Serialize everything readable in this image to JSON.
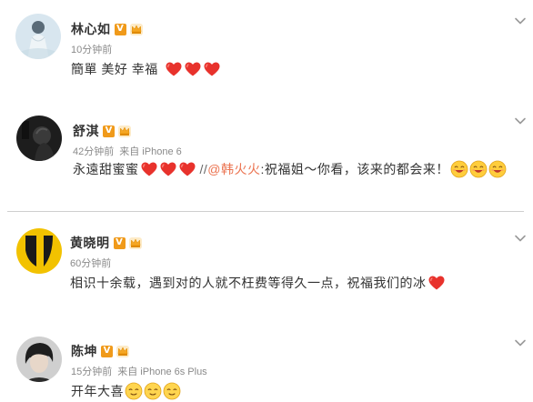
{
  "posts": [
    {
      "name": "林心如",
      "time": "10分钟前",
      "source": "",
      "text": "簡單 美好 幸福",
      "emoji": [
        "heart-emoji",
        "heart-emoji",
        "heart-emoji"
      ]
    },
    {
      "name": "舒淇",
      "time": "42分钟前",
      "source": "来自 iPhone 6",
      "text": "永遠甜蜜蜜",
      "emoji_after_text": [
        "heart-emoji",
        "heart-emoji",
        "heart-emoji"
      ],
      "separator": "//",
      "mention": "@韩火火",
      "text2": ":祝福姐～你看，该来的都会来！",
      "emoji_end": [
        "grin-emoji",
        "grin-emoji",
        "grin-emoji"
      ]
    },
    {
      "name": "黄晓明",
      "time": "60分钟前",
      "source": "",
      "text": "相识十余载，遇到对的人就不枉费等得久一点，祝福我们的冰",
      "emoji": [
        "heart-emoji"
      ]
    },
    {
      "name": "陈坤",
      "time": "15分钟前",
      "source": "来自 iPhone 6s Plus",
      "text": "开年大喜",
      "emoji": [
        "content-emoji",
        "content-emoji",
        "content-emoji"
      ]
    }
  ],
  "badge_letter": "V",
  "colors": {
    "badge": "#f09a1a",
    "mention": "#eb7350",
    "meta": "#8a8a8a",
    "heart": "#e8322c",
    "emoji_face": "#ffcd3c"
  }
}
